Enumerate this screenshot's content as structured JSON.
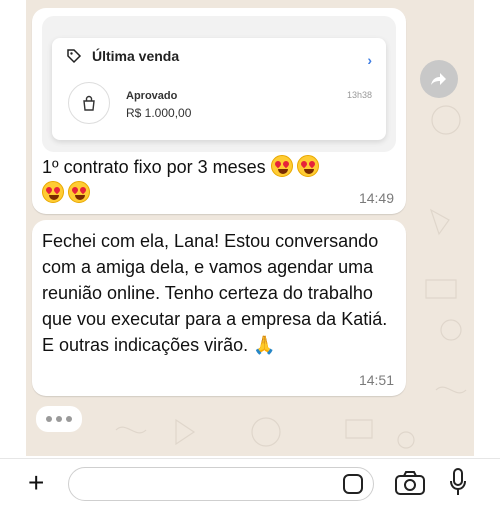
{
  "card": {
    "title": "Última venda",
    "status": "Aprovado",
    "amount": "R$ 1.000,00",
    "time": "13h38"
  },
  "messages": [
    {
      "text": "1º contrato fixo por 3 meses",
      "time": "14:49"
    },
    {
      "text": "Fechei com ela, Lana! Estou conversando com a amiga dela, e vamos agendar uma reunião online. Tenho certeza do trabalho que vou executar para a empresa da Katiá. E outras indicações virão.",
      "time": "14:51"
    }
  ]
}
